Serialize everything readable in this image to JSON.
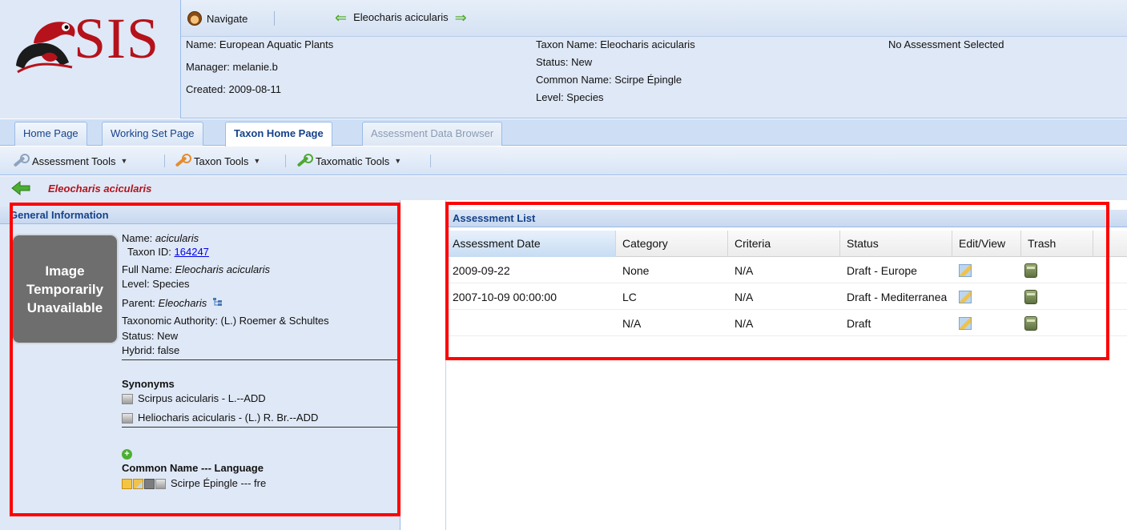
{
  "app": {
    "logo_text": "SIS"
  },
  "nav": {
    "navigate_label": "Navigate",
    "current_taxon": "Eleocharis acicularis"
  },
  "working_set": {
    "name": "Name: European Aquatic Plants",
    "manager": "Manager: melanie.b",
    "created": "Created: 2009-08-11"
  },
  "taxon_summary": {
    "taxon_name": "Taxon Name: Eleocharis acicularis",
    "status": "Status: New",
    "common_name": "Common Name: Scirpe Épingle",
    "level": "Level: Species"
  },
  "assessment_status": "No Assessment Selected",
  "tabs": [
    {
      "label": "Home Page"
    },
    {
      "label": "Working Set Page"
    },
    {
      "label": "Taxon Home Page"
    },
    {
      "label": "Assessment Data Browser"
    }
  ],
  "toolbar": {
    "assessment_tools": "Assessment Tools",
    "taxon_tools": "Taxon Tools",
    "taxomatic_tools": "Taxomatic Tools"
  },
  "breadcrumb": {
    "taxon": "Eleocharis acicularis"
  },
  "general_info": {
    "title": "General Information",
    "image_text": [
      "Image",
      "Temporarily",
      "Unavailable"
    ],
    "name_label": "Name: ",
    "name_value": "acicularis",
    "taxon_id_label": "Taxon ID: ",
    "taxon_id_value": "164247",
    "full_name_label": "Full Name: ",
    "full_name_value": "Eleocharis acicularis",
    "level": "Level: Species",
    "parent_label": "Parent: ",
    "parent_value": "Eleocharis",
    "authority": "Taxonomic Authority: (L.) Roemer & Schultes",
    "status": "Status: New",
    "hybrid": "Hybrid: false",
    "synonyms_title": "Synonyms",
    "synonyms": [
      "Scirpus acicularis - L.--ADD",
      "Heliocharis acicularis - (L.) R. Br.--ADD"
    ],
    "common_names_title": "Common Name --- Language",
    "common_names": [
      "Scirpe Épingle --- fre"
    ]
  },
  "assessment_list": {
    "title": "Assessment List",
    "columns": [
      "Assessment Date",
      "Category",
      "Criteria",
      "Status",
      "Edit/View",
      "Trash"
    ],
    "rows": [
      {
        "date": "2009-09-22",
        "category": "None",
        "criteria": "N/A",
        "status": "Draft - Europe"
      },
      {
        "date": "2007-10-09 00:00:00",
        "category": "LC",
        "criteria": "N/A",
        "status": "Draft - Mediterranea"
      },
      {
        "date": "",
        "category": "N/A",
        "criteria": "N/A",
        "status": "Draft"
      }
    ]
  },
  "colors": {
    "brand_red": "#b5121b",
    "panel_blue": "#dfe8f6",
    "header_text": "#15428b",
    "highlight_red": "#ff0000"
  },
  "icons": [
    "logo-frog-icon",
    "monkey-icon",
    "back-arrow-icon",
    "forward-arrow-icon",
    "wrench-icon",
    "tree-icon",
    "add-icon",
    "edit-icon",
    "trash-icon"
  ]
}
